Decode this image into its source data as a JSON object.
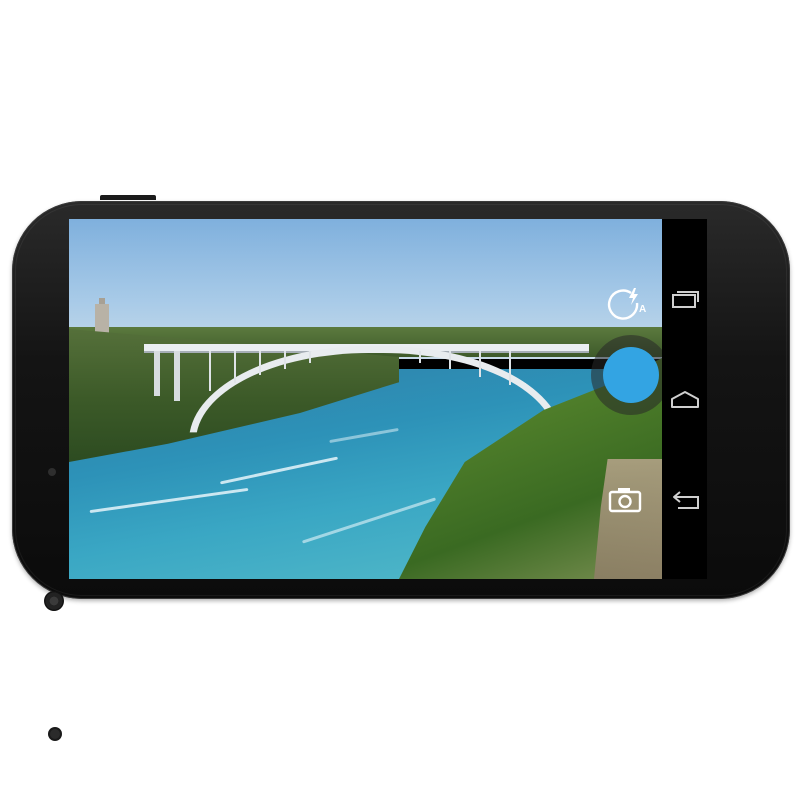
{
  "device": {
    "model": "",
    "orientation": "landscape"
  },
  "camera_app": {
    "flash_mode": "auto",
    "flash_mode_label": "A",
    "shutter_color": "#33a4e3",
    "mode": "photo"
  },
  "navbar": {
    "buttons": [
      "recents",
      "home",
      "back"
    ]
  },
  "icons": {
    "flash": "flash-auto-icon",
    "mode": "camera-icon",
    "recents": "recents-icon",
    "home": "home-icon",
    "back": "back-icon"
  }
}
